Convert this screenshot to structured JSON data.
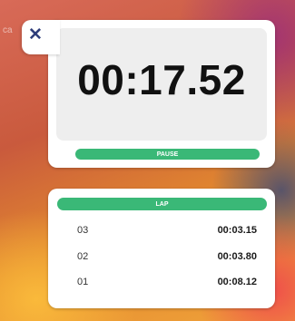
{
  "close": {
    "icon": "close-icon",
    "glyph": "✕"
  },
  "timer": {
    "time": "00:17.52",
    "pause_label": "PAUSE"
  },
  "laps": {
    "lap_label": "LAP",
    "rows": [
      {
        "number": "03",
        "time": "00:03.15"
      },
      {
        "number": "02",
        "time": "00:03.80"
      },
      {
        "number": "01",
        "time": "00:08.12"
      }
    ]
  },
  "colors": {
    "accent_green": "#3ab877",
    "close_icon": "#2e3d7a",
    "card_bg": "#ffffff",
    "time_panel_bg": "#eeeeee"
  }
}
